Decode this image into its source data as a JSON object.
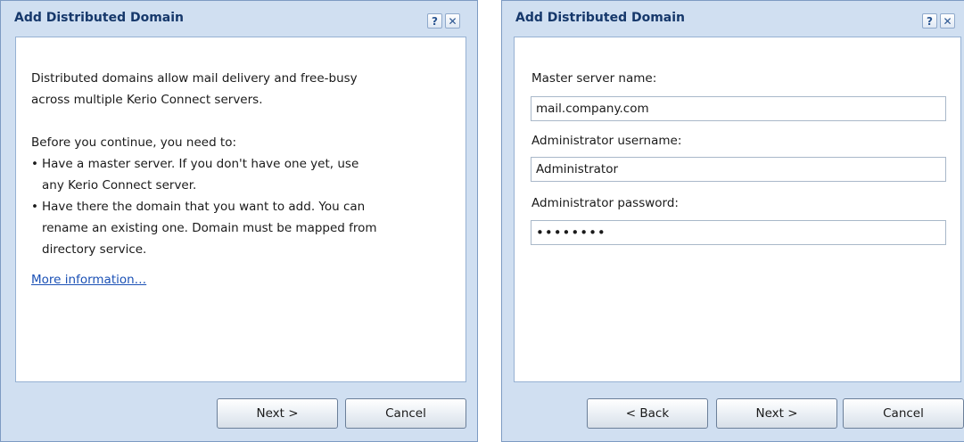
{
  "dialog1": {
    "title": "Add Distributed Domain",
    "help_label": "?",
    "close_label": "✕",
    "intro_line1": "Distributed domains allow mail delivery and free-busy",
    "intro_line2": "across multiple Kerio Connect servers.",
    "before_text": "Before you continue, you need to:",
    "bullets": [
      {
        "line1": "Have a master server. If you don't have one yet, use",
        "line2": "any Kerio Connect server."
      },
      {
        "line1": "Have there the domain that you want to add. You can",
        "line2": "rename an existing one. Domain must be mapped from",
        "line3": "directory service."
      }
    ],
    "bullet_glyph": "•",
    "more_info_link": "More information…",
    "buttons": {
      "next": "Next >",
      "cancel": "Cancel"
    }
  },
  "dialog2": {
    "title": "Add Distributed Domain",
    "help_label": "?",
    "close_label": "✕",
    "master_label": "Master server name:",
    "master_value": "mail.company.com",
    "username_label": "Administrator username:",
    "username_value": "Administrator",
    "password_label": "Administrator password:",
    "password_value": "••••••••",
    "buttons": {
      "back": "< Back",
      "next": "Next >",
      "cancel": "Cancel"
    }
  }
}
